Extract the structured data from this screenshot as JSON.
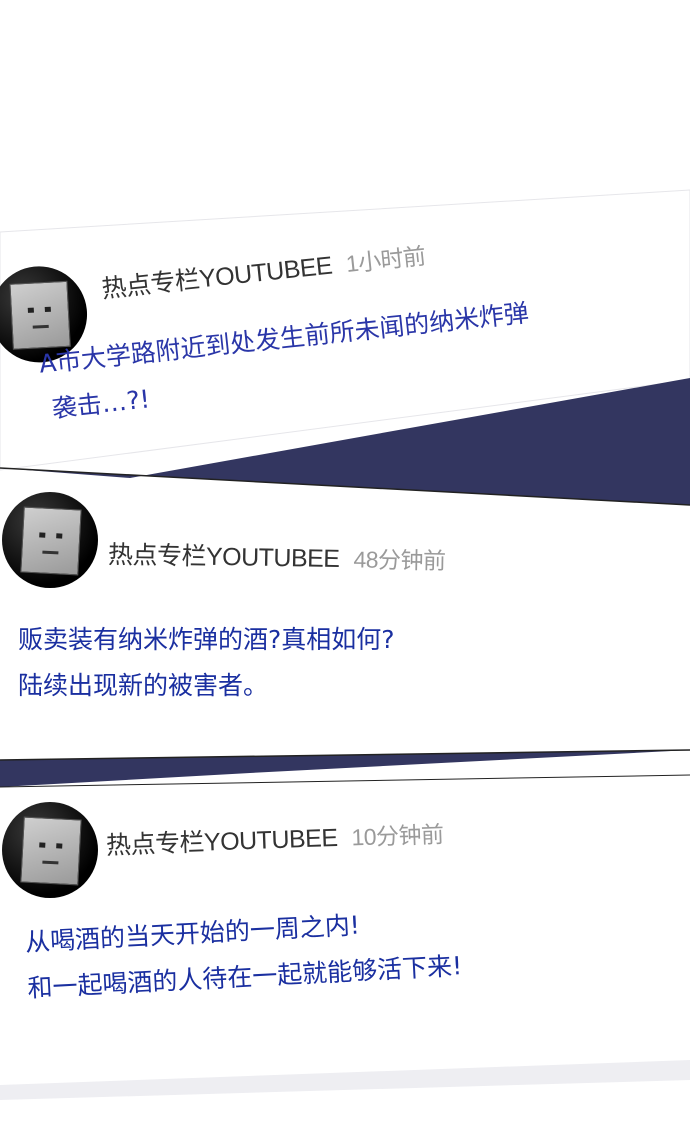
{
  "colors": {
    "navy_band": "#333660",
    "message_text": "#1a2fa0",
    "author_text": "#333333",
    "timestamp_text": "#9a9a9a"
  },
  "posts": [
    {
      "author": "热点专栏YOUTUBEE",
      "time": "1小时前",
      "lines": [
        "A市大学路附近到处发生前所未闻的纳米炸弹",
        "袭击…?!"
      ]
    },
    {
      "author": "热点专栏YOUTUBEE",
      "time": "48分钟前",
      "lines": [
        "贩卖装有纳米炸弹的酒?真相如何?",
        "陆续出现新的被害者。"
      ]
    },
    {
      "author": "热点专栏YOUTUBEE",
      "time": "10分钟前",
      "lines": [
        "从喝酒的当天开始的一周之内!",
        "和一起喝酒的人待在一起就能够活下来!"
      ]
    }
  ]
}
